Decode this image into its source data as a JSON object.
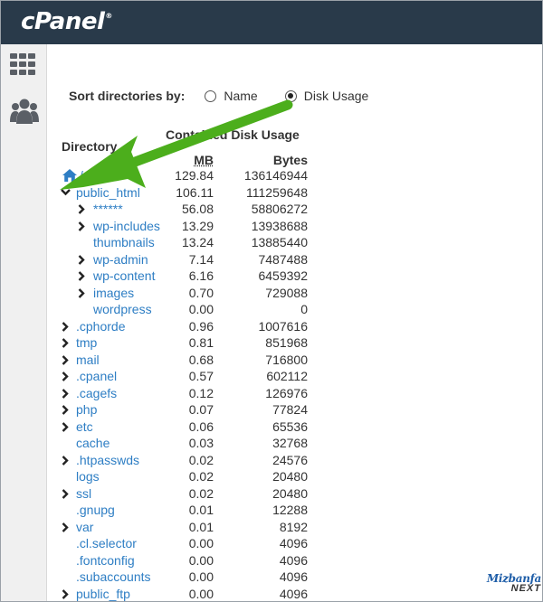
{
  "header": {
    "logo_text": "cPanel",
    "logo_mark": "®",
    "background_color": "#293a4a"
  },
  "sidebar": {
    "items": [
      {
        "icon": "grid-icon",
        "label": ""
      },
      {
        "icon": "users-icon",
        "label": ""
      }
    ]
  },
  "sort": {
    "label": "Sort directories by:",
    "options": [
      {
        "label": "Name",
        "checked": false
      },
      {
        "label": "Disk Usage",
        "checked": true
      }
    ]
  },
  "table": {
    "headers": {
      "directory": "Directory",
      "contained": "Contained Disk Usage",
      "mb": "MB",
      "bytes": "Bytes"
    },
    "rows": [
      {
        "name": "/",
        "mb": "129.84",
        "bytes": "136146944",
        "depth": 0,
        "toggle": "home"
      },
      {
        "name": "public_html",
        "mb": "106.11",
        "bytes": "111259648",
        "depth": 0,
        "toggle": "expanded"
      },
      {
        "name": "******",
        "mb": "56.08",
        "bytes": "58806272",
        "depth": 1,
        "toggle": "collapsed"
      },
      {
        "name": "wp-includes",
        "mb": "13.29",
        "bytes": "13938688",
        "depth": 1,
        "toggle": "collapsed"
      },
      {
        "name": "thumbnails",
        "mb": "13.24",
        "bytes": "13885440",
        "depth": 1,
        "toggle": "none"
      },
      {
        "name": "wp-admin",
        "mb": "7.14",
        "bytes": "7487488",
        "depth": 1,
        "toggle": "collapsed"
      },
      {
        "name": "wp-content",
        "mb": "6.16",
        "bytes": "6459392",
        "depth": 1,
        "toggle": "collapsed"
      },
      {
        "name": "images",
        "mb": "0.70",
        "bytes": "729088",
        "depth": 1,
        "toggle": "collapsed"
      },
      {
        "name": "wordpress",
        "mb": "0.00",
        "bytes": "0",
        "depth": 1,
        "toggle": "none"
      },
      {
        "name": ".cphorde",
        "mb": "0.96",
        "bytes": "1007616",
        "depth": 0,
        "toggle": "collapsed"
      },
      {
        "name": "tmp",
        "mb": "0.81",
        "bytes": "851968",
        "depth": 0,
        "toggle": "collapsed"
      },
      {
        "name": "mail",
        "mb": "0.68",
        "bytes": "716800",
        "depth": 0,
        "toggle": "collapsed"
      },
      {
        "name": ".cpanel",
        "mb": "0.57",
        "bytes": "602112",
        "depth": 0,
        "toggle": "collapsed"
      },
      {
        "name": ".cagefs",
        "mb": "0.12",
        "bytes": "126976",
        "depth": 0,
        "toggle": "collapsed"
      },
      {
        "name": "php",
        "mb": "0.07",
        "bytes": "77824",
        "depth": 0,
        "toggle": "collapsed"
      },
      {
        "name": "etc",
        "mb": "0.06",
        "bytes": "65536",
        "depth": 0,
        "toggle": "collapsed"
      },
      {
        "name": "cache",
        "mb": "0.03",
        "bytes": "32768",
        "depth": 0,
        "toggle": "none"
      },
      {
        "name": ".htpasswds",
        "mb": "0.02",
        "bytes": "24576",
        "depth": 0,
        "toggle": "collapsed"
      },
      {
        "name": "logs",
        "mb": "0.02",
        "bytes": "20480",
        "depth": 0,
        "toggle": "none"
      },
      {
        "name": "ssl",
        "mb": "0.02",
        "bytes": "20480",
        "depth": 0,
        "toggle": "collapsed"
      },
      {
        "name": ".gnupg",
        "mb": "0.01",
        "bytes": "12288",
        "depth": 0,
        "toggle": "none"
      },
      {
        "name": "var",
        "mb": "0.01",
        "bytes": "8192",
        "depth": 0,
        "toggle": "collapsed"
      },
      {
        "name": ".cl.selector",
        "mb": "0.00",
        "bytes": "4096",
        "depth": 0,
        "toggle": "none"
      },
      {
        "name": ".fontconfig",
        "mb": "0.00",
        "bytes": "4096",
        "depth": 0,
        "toggle": "none"
      },
      {
        "name": ".subaccounts",
        "mb": "0.00",
        "bytes": "4096",
        "depth": 0,
        "toggle": "none"
      },
      {
        "name": "public_ftp",
        "mb": "0.00",
        "bytes": "4096",
        "depth": 0,
        "toggle": "collapsed"
      }
    ]
  },
  "annotation": {
    "arrow_color": "#4cae1c"
  },
  "watermark": {
    "line1": "Mizbanfa",
    "line2": "NEXT"
  },
  "colors": {
    "link": "#2e7ec4",
    "text": "#333333"
  }
}
